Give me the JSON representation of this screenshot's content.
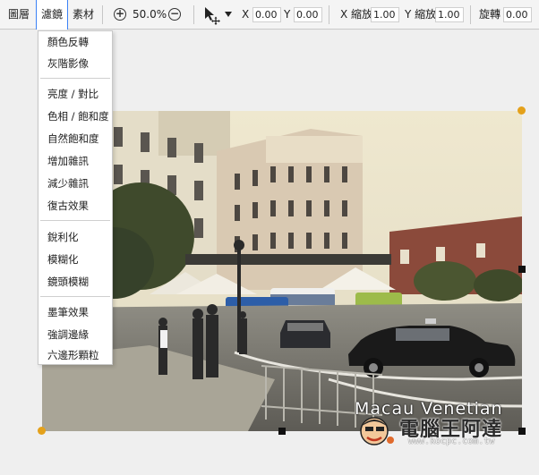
{
  "toolbar": {
    "tabs": [
      {
        "label": "圖層"
      },
      {
        "label": "濾鏡"
      },
      {
        "label": "素材"
      }
    ],
    "zoom": "50.0%",
    "x_label": "X",
    "x_value": "0.00",
    "y_label": "Y",
    "y_value": "0.00",
    "scale_x_label": "X 縮放",
    "scale_x_value": "1.00",
    "scale_y_label": "Y 縮放",
    "scale_y_value": "1.00",
    "rotate_label": "旋轉",
    "rotate_value": "0.00"
  },
  "filter_menu": {
    "groups": [
      [
        "顏色反轉",
        "灰階影像"
      ],
      [
        "亮度 / 對比",
        "色相 / 飽和度",
        "自然飽和度",
        "增加雜訊",
        "減少雜訊",
        "復古效果"
      ],
      [
        "銳利化",
        "模糊化",
        "鏡頭模糊"
      ],
      [
        "墨筆效果",
        "強調邊緣",
        "六邊形顆粒"
      ]
    ]
  },
  "photo": {
    "caption": "Macau Venetian",
    "watermark_site": "電腦王阿達",
    "watermark_url": "www.kocpc.com.tw"
  },
  "colors": {
    "accent": "#3b82f6",
    "handle": "#e4a11b"
  }
}
